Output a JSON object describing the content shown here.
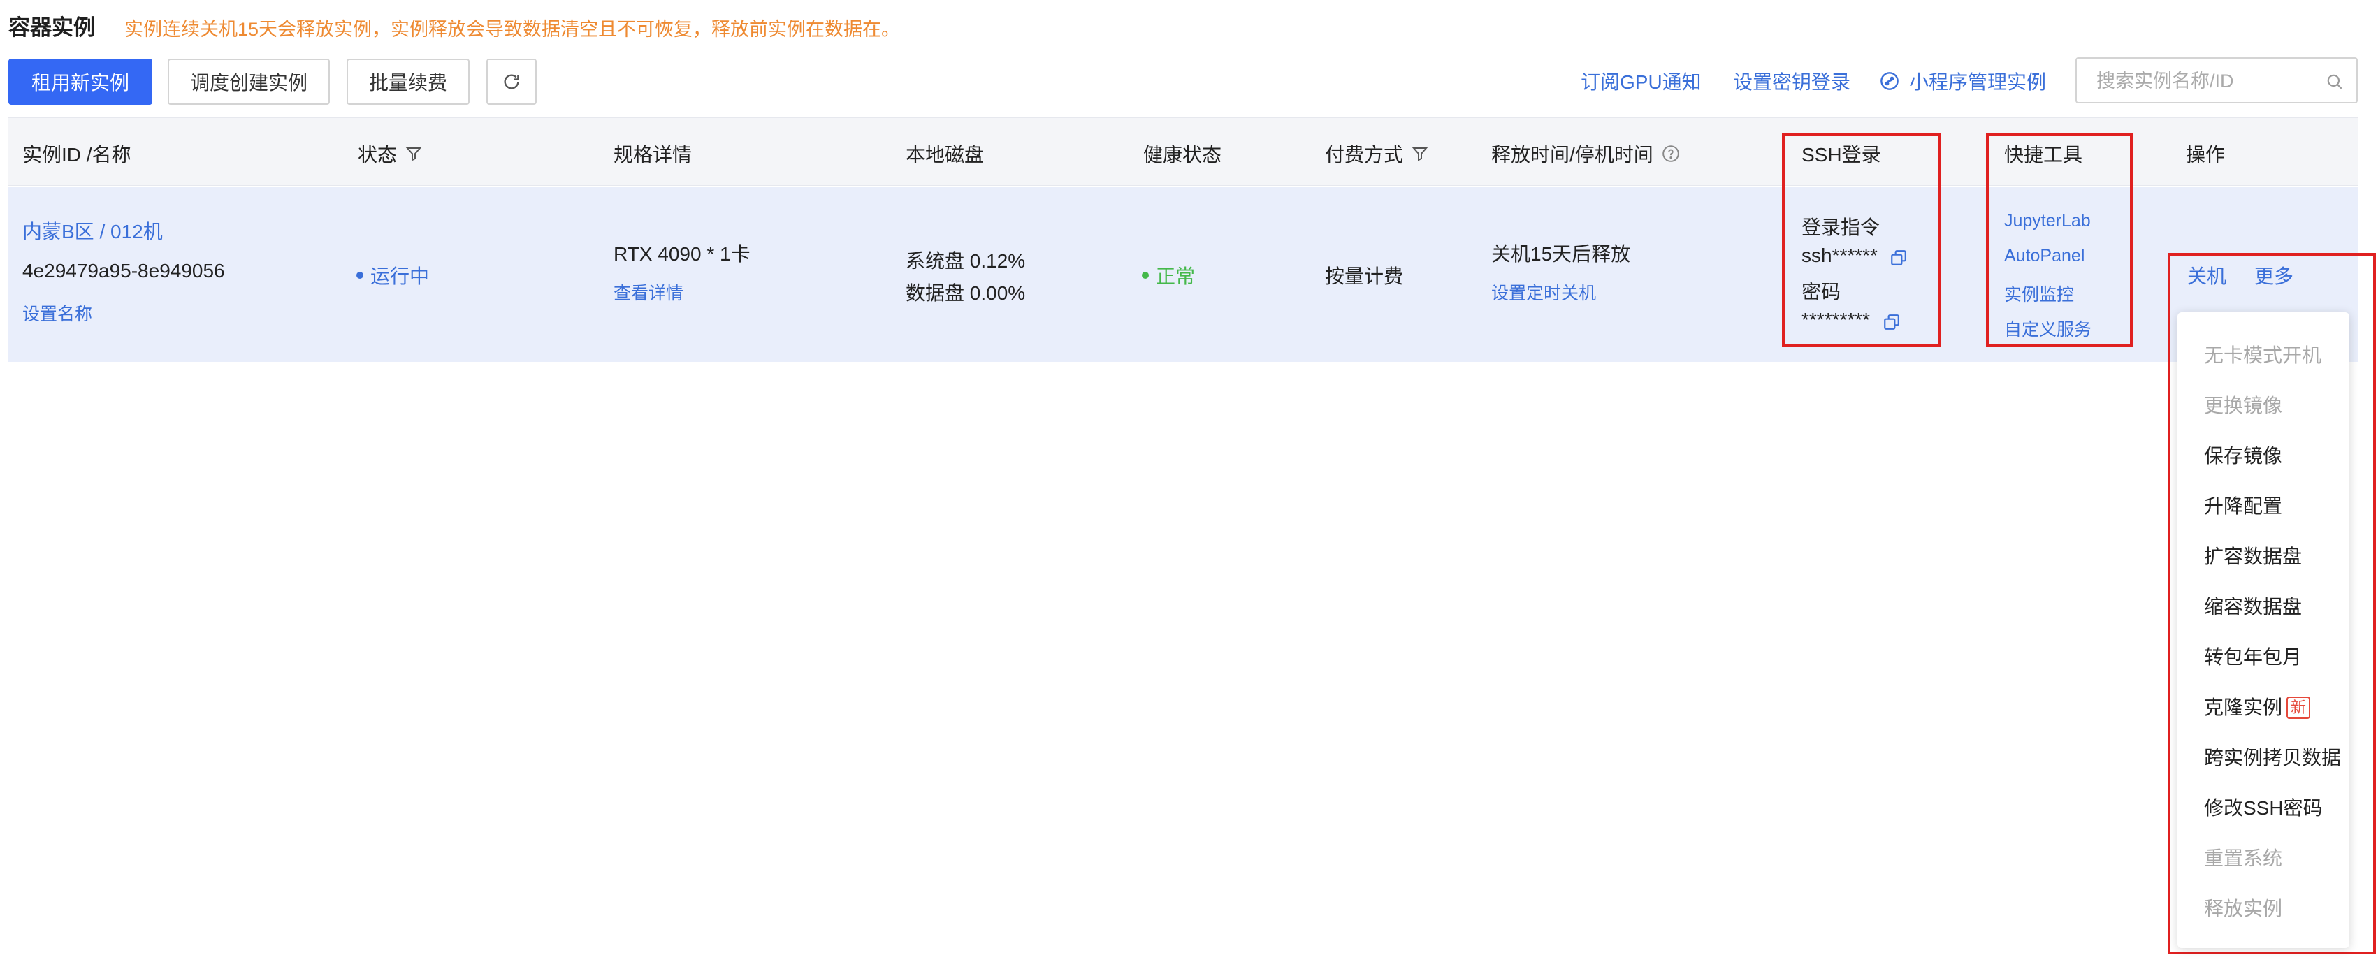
{
  "header": {
    "title": "容器实例",
    "notice": "实例连续关机15天会释放实例，实例释放会导致数据清空且不可恢复，释放前实例在数据在。"
  },
  "toolbar": {
    "rent_button": "租用新实例",
    "schedule_button": "调度创建实例",
    "renew_button": "批量续费",
    "gpu_notify_link": "订阅GPU通知",
    "ssh_key_link": "设置密钥登录",
    "miniprogram_link": "小程序管理实例",
    "search_placeholder": "搜索实例名称/ID"
  },
  "table": {
    "columns": {
      "id_name": "实例ID /名称",
      "status": "状态",
      "spec": "规格详情",
      "disk": "本地磁盘",
      "health": "健康状态",
      "billing": "付费方式",
      "release_time": "释放时间/停机时间",
      "ssh": "SSH登录",
      "tools": "快捷工具",
      "actions": "操作"
    },
    "row": {
      "region_name": "内蒙B区 / 012机",
      "instance_id": "4e29479a95-8e949056",
      "set_name_link": "设置名称",
      "status": "运行中",
      "gpu": "RTX 4090 * 1卡",
      "view_details_link": "查看详情",
      "system_disk": "系统盘 0.12%",
      "data_disk": "数据盘 0.00%",
      "health": "正常",
      "billing": "按量计费",
      "release_info": "关机15天后释放",
      "schedule_shutdown_link": "设置定时关机",
      "ssh_cmd_label": "登录指令",
      "ssh_cmd_value": "ssh******",
      "password_label": "密码",
      "password_value": "*********",
      "tools": [
        "JupyterLab",
        "AutoPanel",
        "实例监控",
        "自定义服务"
      ],
      "shutdown_link": "关机",
      "more_link": "更多"
    }
  },
  "more_menu": {
    "items": [
      {
        "label": "无卡模式开机",
        "disabled": true
      },
      {
        "label": "更换镜像",
        "disabled": true
      },
      {
        "label": "保存镜像",
        "disabled": false
      },
      {
        "label": "升降配置",
        "disabled": false
      },
      {
        "label": "扩容数据盘",
        "disabled": false
      },
      {
        "label": "缩容数据盘",
        "disabled": false
      },
      {
        "label": "转包年包月",
        "disabled": false
      },
      {
        "label": "克隆实例",
        "disabled": false,
        "badge": "新"
      },
      {
        "label": "跨实例拷贝数据",
        "disabled": false
      },
      {
        "label": "修改SSH密码",
        "disabled": false
      },
      {
        "label": "重置系统",
        "disabled": true
      },
      {
        "label": "释放实例",
        "disabled": true
      }
    ]
  },
  "colors": {
    "primary": "#3468f4",
    "link": "#3a6fd9",
    "warning": "#ee8a32",
    "success": "#44b84a",
    "highlight": "#e02020",
    "row_bg": "#e9eefb"
  }
}
